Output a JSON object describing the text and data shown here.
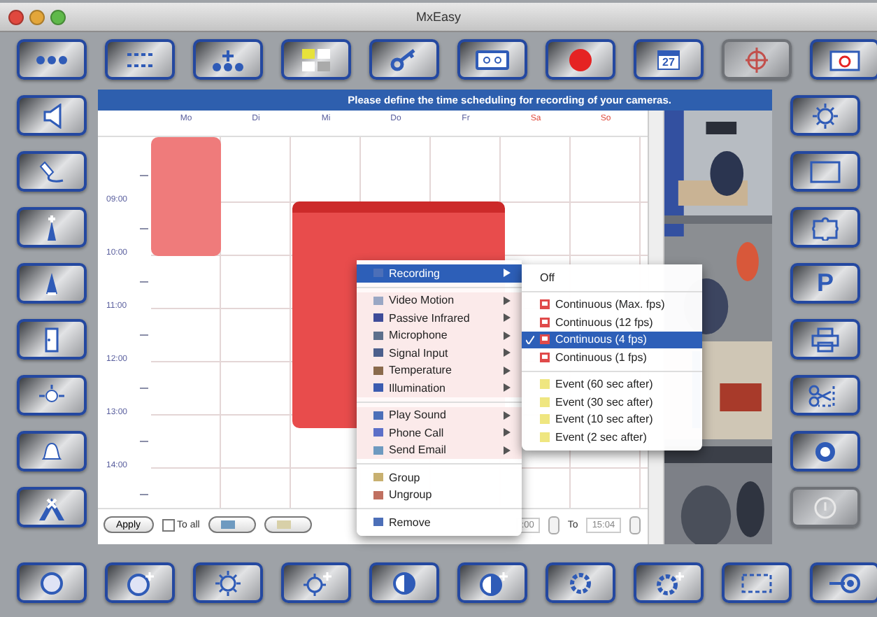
{
  "window": {
    "title": "MxEasy"
  },
  "top_toolbar": [
    {
      "disabled": false
    },
    {
      "disabled": false
    },
    {
      "disabled": false
    },
    {
      "disabled": false
    },
    {
      "disabled": false
    },
    {
      "disabled": false
    },
    {
      "disabled": false
    },
    {
      "disabled": false,
      "label": "27"
    },
    {
      "disabled": true
    },
    {
      "disabled": false
    }
  ],
  "right_toolbar": [
    {
      "disabled": false
    },
    {
      "disabled": false
    },
    {
      "disabled": false
    },
    {
      "disabled": false,
      "label": "P"
    },
    {
      "disabled": false
    },
    {
      "disabled": false
    },
    {
      "disabled": false
    },
    {
      "disabled": true
    }
  ],
  "panel": {
    "header": "Please define the time scheduling for recording of your cameras."
  },
  "schedule": {
    "days": [
      {
        "label": "Mo",
        "weekend": false
      },
      {
        "label": "Di",
        "weekend": false
      },
      {
        "label": "Mi",
        "weekend": false
      },
      {
        "label": "Do",
        "weekend": false
      },
      {
        "label": "Fr",
        "weekend": false
      },
      {
        "label": "Sa",
        "weekend": true
      },
      {
        "label": "So",
        "weekend": true
      }
    ],
    "times": [
      "09:00",
      "10:00",
      "11:00",
      "12:00",
      "13:00",
      "14:00"
    ],
    "events": [
      {
        "selected": false
      },
      {
        "selected": true
      }
    ]
  },
  "bottom_bar": {
    "apply": "Apply",
    "to_all": {
      "label": "To all",
      "checked": false
    },
    "from_value": ":00",
    "to_label": "To",
    "to_value": "15:04"
  },
  "context_menu": {
    "groups": [
      [
        {
          "label": "Recording",
          "submenu": true,
          "selected": true
        }
      ],
      [
        {
          "label": "Video Motion",
          "submenu": true,
          "selected": false
        },
        {
          "label": "Passive Infrared",
          "submenu": true,
          "selected": false
        },
        {
          "label": "Microphone",
          "submenu": true,
          "selected": false
        },
        {
          "label": "Signal Input",
          "submenu": true,
          "selected": false
        },
        {
          "label": "Temperature",
          "submenu": true,
          "selected": false
        },
        {
          "label": "Illumination",
          "submenu": true,
          "selected": false
        }
      ],
      [
        {
          "label": "Play Sound",
          "submenu": true,
          "selected": false
        },
        {
          "label": "Phone Call",
          "submenu": true,
          "selected": false
        },
        {
          "label": "Send Email",
          "submenu": true,
          "selected": false
        }
      ],
      [
        {
          "label": "Group",
          "submenu": false,
          "selected": false
        },
        {
          "label": "Ungroup",
          "submenu": false,
          "selected": false
        }
      ],
      [
        {
          "label": "Remove",
          "submenu": false,
          "selected": false
        }
      ]
    ]
  },
  "submenu": {
    "groups": [
      [
        {
          "label": "Off",
          "kind": "off",
          "selected": false
        }
      ],
      [
        {
          "label": "Continuous (Max. fps)",
          "kind": "continuous",
          "selected": false
        },
        {
          "label": "Continuous (12 fps)",
          "kind": "continuous",
          "selected": false
        },
        {
          "label": "Continuous (4 fps)",
          "kind": "continuous",
          "selected": true
        },
        {
          "label": "Continuous (1 fps)",
          "kind": "continuous",
          "selected": false
        }
      ],
      [
        {
          "label": "Event (60 sec after)",
          "kind": "event",
          "selected": false
        },
        {
          "label": "Event (30 sec after)",
          "kind": "event",
          "selected": false
        },
        {
          "label": "Event (10 sec after)",
          "kind": "event",
          "selected": false
        },
        {
          "label": "Event (2 sec after)",
          "kind": "event",
          "selected": false
        }
      ]
    ]
  }
}
